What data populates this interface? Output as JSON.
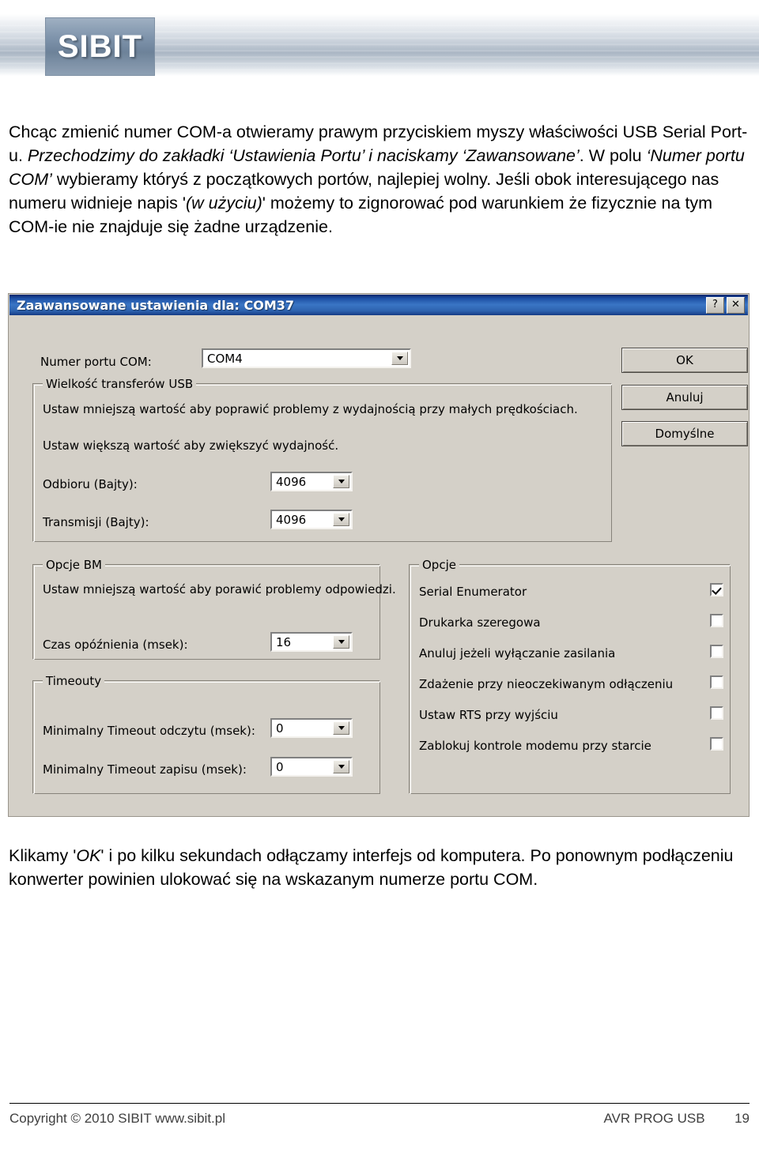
{
  "banner": {
    "logo_text": "SIBIT"
  },
  "paragraphs": {
    "intro_html": "Chcąc zmienić numer COM-a otwieramy prawym przyciskiem myszy właściwości USB Serial Port-u. <i>Przechodzimy do zakładki &#8216;Ustawienia Portu&#8217; i naciskamy &#8216;Zawansowane&#8217;</i>. W polu <i>&#8216;Numer portu COM&#8217;</i> wybieramy któryś z początkowych portów, najlepiej wolny. Jeśli obok interesującego nas numeru widnieje napis '<i>(w użyciu)</i>' możemy to zignorować pod warunkiem że fizycznie na tym COM-ie nie znajduje się żadne urządzenie.",
    "outro_html": "Klikamy '<i>OK</i>' i po kilku sekundach odłączamy interfejs od komputera. Po ponownym podłączeniu konwerter powinien ulokować się na wskazanym numerze portu COM."
  },
  "dialog": {
    "title": "Zaawansowane ustawienia dla: COM37",
    "titlebar_help": "?",
    "titlebar_close": "✕",
    "com_port_label": "Numer portu COM:",
    "com_port_value": "COM4",
    "buttons": {
      "ok": "OK",
      "cancel": "Anuluj",
      "defaults": "Domyślne"
    },
    "usb_group": {
      "title": "Wielkość transferów USB",
      "hint1": "Ustaw mniejszą wartość aby poprawić problemy z wydajnością przy małych prędkościach.",
      "hint2": "Ustaw większą wartość aby zwiększyć wydajność.",
      "rx_label": "Odbioru (Bajty):",
      "rx_value": "4096",
      "tx_label": "Transmisji (Bajty):",
      "tx_value": "4096"
    },
    "bm_group": {
      "title": "Opcje BM",
      "hint": "Ustaw mniejszą wartość aby porawić problemy odpowiedzi.",
      "latency_label": "Czas opóźnienia (msek):",
      "latency_value": "16"
    },
    "timeouts_group": {
      "title": "Timeouty",
      "read_label": "Minimalny Timeout odczytu (msek):",
      "read_value": "0",
      "write_label": "Minimalny Timeout zapisu (msek):",
      "write_value": "0"
    },
    "options_group": {
      "title": "Opcje",
      "items": [
        {
          "label": "Serial Enumerator",
          "checked": true
        },
        {
          "label": "Drukarka szeregowa",
          "checked": false
        },
        {
          "label": "Anuluj jeżeli wyłączanie zasilania",
          "checked": false
        },
        {
          "label": "Zdażenie przy nieoczekiwanym odłączeniu",
          "checked": false
        },
        {
          "label": "Ustaw RTS przy wyjściu",
          "checked": false
        },
        {
          "label": "Zablokuj kontrole modemu przy starcie",
          "checked": false
        }
      ]
    }
  },
  "footer": {
    "left": "Copyright © 2010 SIBIT www.sibit.pl",
    "right": "AVR PROG USB",
    "page": "19"
  }
}
